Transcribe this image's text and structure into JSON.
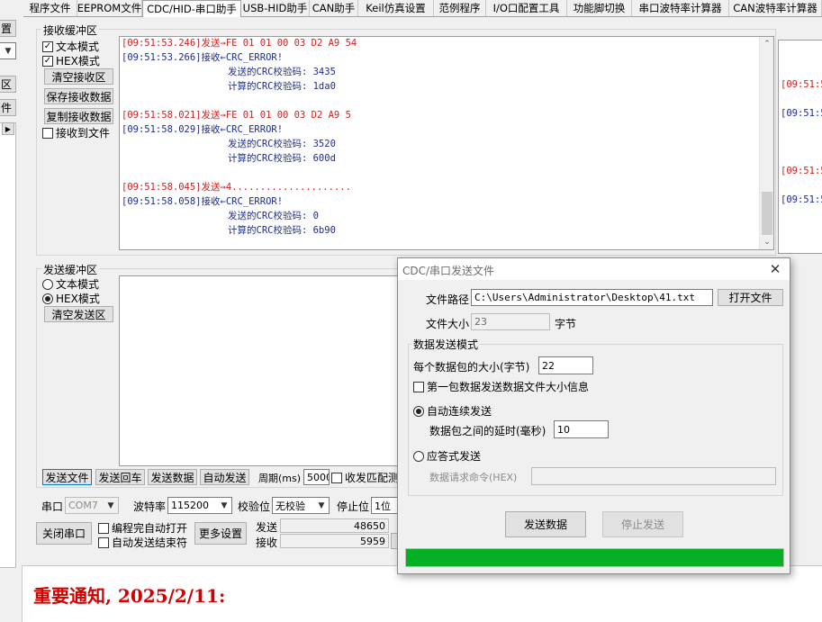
{
  "left_strip": {
    "btn1": "置",
    "btn2": "区",
    "btn3": "件"
  },
  "tabs": [
    {
      "label": "程序文件"
    },
    {
      "label": "EEPROM文件"
    },
    {
      "label": "CDC/HID-串口助手"
    },
    {
      "label": "USB-HID助手"
    },
    {
      "label": "CAN助手"
    },
    {
      "label": "Keil仿真设置"
    },
    {
      "label": "范例程序"
    },
    {
      "label": "I/O口配置工具"
    },
    {
      "label": "功能脚切换"
    },
    {
      "label": "串口波特率计算器"
    },
    {
      "label": "CAN波特率计算器"
    }
  ],
  "receive": {
    "title": "接收缓冲区",
    "text_mode": "文本模式",
    "hex_mode": "HEX模式",
    "clear_btn": "清空接收区",
    "save_btn": "保存接收数据",
    "copy_btn": "复制接收数据",
    "to_file": "接收到文件",
    "log": {
      "l0": "[09:51:53.246]发送→FE 01 01 00 03 D2 A9 54",
      "l1": "[09:51:53.266]接收←CRC_ERROR!",
      "l2": "发送的CRC校验码:  3435",
      "l3": "计算的CRC校验码:  1da0",
      "l4": "[09:51:58.021]发送→FE 01 01 00 03 D2 A9 5",
      "l5": "[09:51:58.029]接收←CRC_ERROR!",
      "l6": "发送的CRC校验码:  3520",
      "l7": "计算的CRC校验码:  600d",
      "l8": "[09:51:58.045]发送→4.....................",
      "l9": "[09:51:58.058]接收←CRC_ERROR!",
      "l10": "发送的CRC校验码:  0",
      "l11": "计算的CRC校验码:  6b90"
    },
    "right_log": [
      "[09:51:5",
      "[09:51:5",
      "[09:51:5",
      "[09:51:5"
    ]
  },
  "send": {
    "title": "发送缓冲区",
    "text_mode": "文本模式",
    "hex_mode": "HEX模式",
    "clear_btn": "清空发送区"
  },
  "bottom": {
    "send_file": "发送文件",
    "send_return": "发送回车",
    "send_data": "发送数据",
    "auto_send": "自动发送",
    "period_label": "周期(ms)",
    "period_value": "5000",
    "match_label": "收发匹配测",
    "port_label": "串口",
    "port_value": "COM7",
    "baud_label": "波特率",
    "baud_value": "115200",
    "parity_label": "校验位",
    "parity_value": "无校验",
    "stop_label": "停止位",
    "stop_value": "1位",
    "close_port": "关闭串口",
    "auto_open": "编程完自动打开",
    "auto_end": "自动发送结束符",
    "more": "更多设置",
    "tx_label": "发送",
    "tx_value": "48650",
    "rx_label": "接收",
    "rx_value": "5959"
  },
  "notice": "重要通知, 2025/2/11:",
  "dialog": {
    "title": "CDC/串口发送文件",
    "path_label": "文件路径",
    "path_value": "C:\\Users\\Administrator\\Desktop\\41.txt",
    "open_btn": "打开文件",
    "size_label": "文件大小",
    "size_value": "23",
    "size_unit": "字节",
    "mode_title": "数据发送模式",
    "packet_label": "每个数据包的大小(字节)",
    "packet_value": "22",
    "first_packet": "第一包数据发送数据文件大小信息",
    "auto_label": "自动连续发送",
    "delay_label": "数据包之间的延时(毫秒)",
    "delay_value": "10",
    "answer_label": "应答式发送",
    "request_label": "数据请求命令(HEX)",
    "send_btn": "发送数据",
    "stop_btn": "停止发送",
    "progress": 1.0,
    "progress_color": "#06b025"
  }
}
